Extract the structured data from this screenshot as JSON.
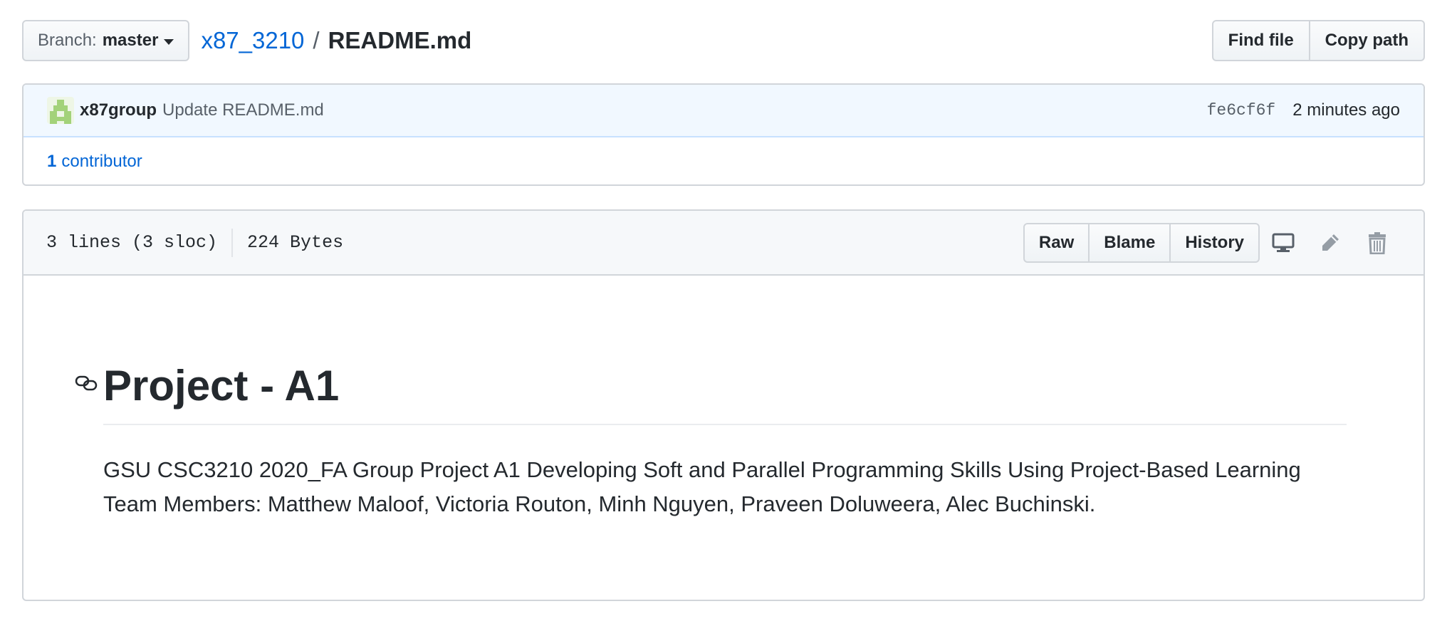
{
  "branch": {
    "label": "Branch:",
    "value": "master"
  },
  "breadcrumb": {
    "repo": "x87_3210",
    "separator": "/",
    "file": "README.md"
  },
  "header_actions": {
    "find_file": "Find file",
    "copy_path": "Copy path"
  },
  "commit": {
    "author": "x87group",
    "message": "Update README.md",
    "sha": "fe6cf6f",
    "time": "2 minutes ago",
    "contributors_count": "1",
    "contributors_label": "contributor"
  },
  "file": {
    "lines": "3 lines (3 sloc)",
    "size": "224 Bytes",
    "actions": {
      "raw": "Raw",
      "blame": "Blame",
      "history": "History"
    },
    "icons": [
      "desktop-icon",
      "pencil-icon",
      "trash-icon"
    ]
  },
  "readme": {
    "title": "Project - A1",
    "body": "GSU CSC3210 2020_FA Group Project A1 Developing Soft and Parallel Programming Skills Using Project-Based Learning Team Members: Matthew Maloof, Victoria Routon, Minh Nguyen, Praveen Doluweera, Alec Buchinski."
  },
  "colors": {
    "link": "#0366d6",
    "commit_bg": "#f1f8ff",
    "avatar": "#a3d27a",
    "border": "#d1d5da"
  }
}
